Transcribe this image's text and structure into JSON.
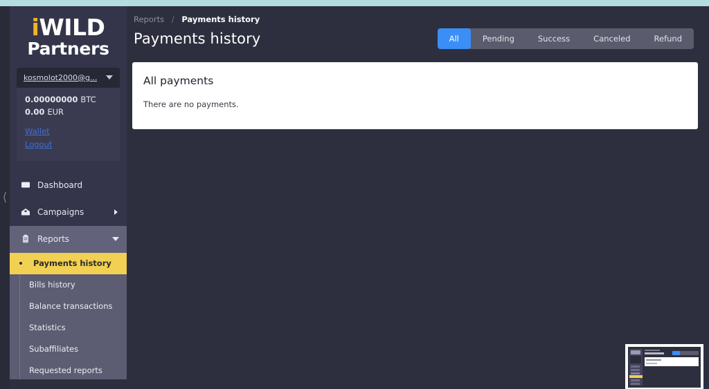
{
  "theme": {
    "top_strip_color": "#b4dde2",
    "page_background": "#2e2f3e",
    "sidebar_background": "#34354a",
    "accent_yellow": "#f2d051",
    "accent_blue": "#3b8ef5",
    "link_blue": "#3f6fd8",
    "logo_gold": "#f0b429"
  },
  "sidebar": {
    "collapse_icon": "chevron-left-icon",
    "logo": {
      "initial": "i",
      "word": "WILD",
      "subtitle": "Partners"
    },
    "user": {
      "email": "kosmolot2000@g...",
      "dropdown_icon": "chevron-down-icon",
      "balances": [
        {
          "amount": "0.00000000",
          "currency": "BTC"
        },
        {
          "amount": "0.00",
          "currency": "EUR"
        }
      ],
      "links": [
        {
          "label": "Wallet"
        },
        {
          "label": "Logout"
        }
      ]
    },
    "nav": [
      {
        "label": "Dashboard",
        "icon": "monitor-icon",
        "state": "normal",
        "arrow": "none"
      },
      {
        "label": "Campaigns",
        "icon": "home-icon",
        "state": "normal",
        "arrow": "right"
      },
      {
        "label": "Reports",
        "icon": "clipboard-icon",
        "state": "expanded",
        "arrow": "down"
      }
    ],
    "submenu": [
      {
        "label": "Payments history",
        "active": true
      },
      {
        "label": "Bills history",
        "active": false
      },
      {
        "label": "Balance transactions",
        "active": false
      },
      {
        "label": "Statistics",
        "active": false
      },
      {
        "label": "Subaffiliates",
        "active": false
      },
      {
        "label": "Requested reports",
        "active": false
      }
    ]
  },
  "main": {
    "breadcrumb": {
      "parent": "Reports",
      "separator": "/",
      "current": "Payments history"
    },
    "page_title": "Payments history",
    "filter_tabs": [
      {
        "label": "All",
        "active": true
      },
      {
        "label": "Pending",
        "active": false
      },
      {
        "label": "Success",
        "active": false
      },
      {
        "label": "Canceled",
        "active": false
      },
      {
        "label": "Refund",
        "active": false
      }
    ],
    "card": {
      "title": "All payments",
      "empty_message": "There are no payments."
    }
  },
  "thumbnail": {
    "name": "page-preview-thumbnail"
  }
}
